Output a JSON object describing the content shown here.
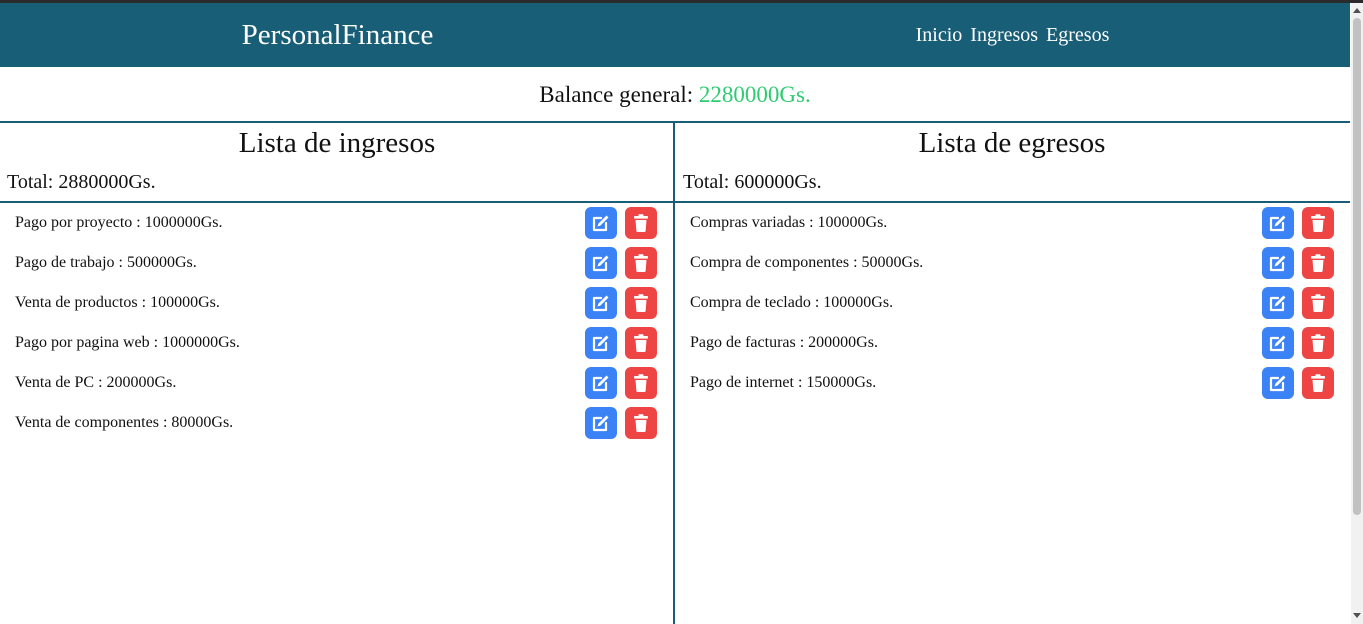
{
  "navbar": {
    "brand": "PersonalFinance",
    "links": [
      "Inicio",
      "Ingresos",
      "Egresos"
    ]
  },
  "balance": {
    "label": "Balance general: ",
    "value": "2280000Gs."
  },
  "ingresos": {
    "title": "Lista de ingresos",
    "total": "Total: 2880000Gs.",
    "items": [
      "Pago por proyecto : 1000000Gs.",
      "Pago de trabajo : 500000Gs.",
      "Venta de productos : 100000Gs.",
      "Pago por pagina web : 1000000Gs.",
      "Venta de PC : 200000Gs.",
      "Venta de componentes : 80000Gs."
    ]
  },
  "egresos": {
    "title": "Lista de egresos",
    "total": "Total: 600000Gs.",
    "items": [
      "Compras variadas : 100000Gs.",
      "Compra de componentes : 50000Gs.",
      "Compra de teclado : 100000Gs.",
      "Pago de facturas : 200000Gs.",
      "Pago de internet : 150000Gs."
    ]
  },
  "icons": {
    "edit": "edit-icon",
    "delete": "trash-icon"
  },
  "colors": {
    "navbar": "#195e77",
    "balance_value": "#2ecc71",
    "edit_button": "#3b82f6",
    "delete_button": "#ef4444"
  }
}
